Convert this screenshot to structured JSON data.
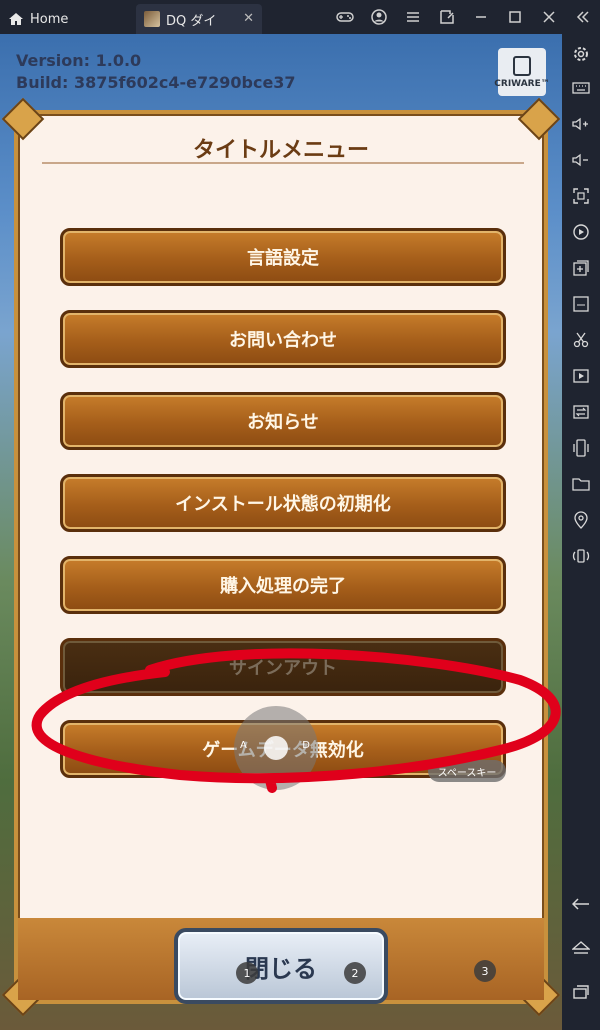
{
  "titlebar": {
    "home_label": "Home",
    "game_tab_label": "DQ ダイ",
    "close_glyph": "✕",
    "buttons": [
      "gamepad-icon",
      "account-icon",
      "menu-icon",
      "screenshot-icon",
      "minimize-icon",
      "maximize-icon",
      "close-icon",
      "collapse-icon"
    ]
  },
  "game": {
    "version_line": "Version: 1.0.0",
    "build_line": "Build: 3875f602c4-e7290bce37",
    "criware_label": "CRIWARE™"
  },
  "dialog": {
    "title": "タイトルメニュー",
    "items": [
      {
        "label": "言語設定",
        "enabled": true
      },
      {
        "label": "お問い合わせ",
        "enabled": true
      },
      {
        "label": "お知らせ",
        "enabled": true
      },
      {
        "label": "インストール状態の初期化",
        "enabled": true
      },
      {
        "label": "購入処理の完了",
        "enabled": true
      },
      {
        "label": "サインアウト",
        "enabled": false
      },
      {
        "label": "ゲームデータ無効化",
        "enabled": true
      }
    ],
    "close_label": "閉じる"
  },
  "overlay": {
    "left_letter": "A",
    "right_letter": "D",
    "space_key_label": "スペースキー",
    "badges": [
      "1",
      "2",
      "3"
    ]
  },
  "colors": {
    "accent_brown": "#a55e1a",
    "annotation_red": "#e0001b"
  }
}
